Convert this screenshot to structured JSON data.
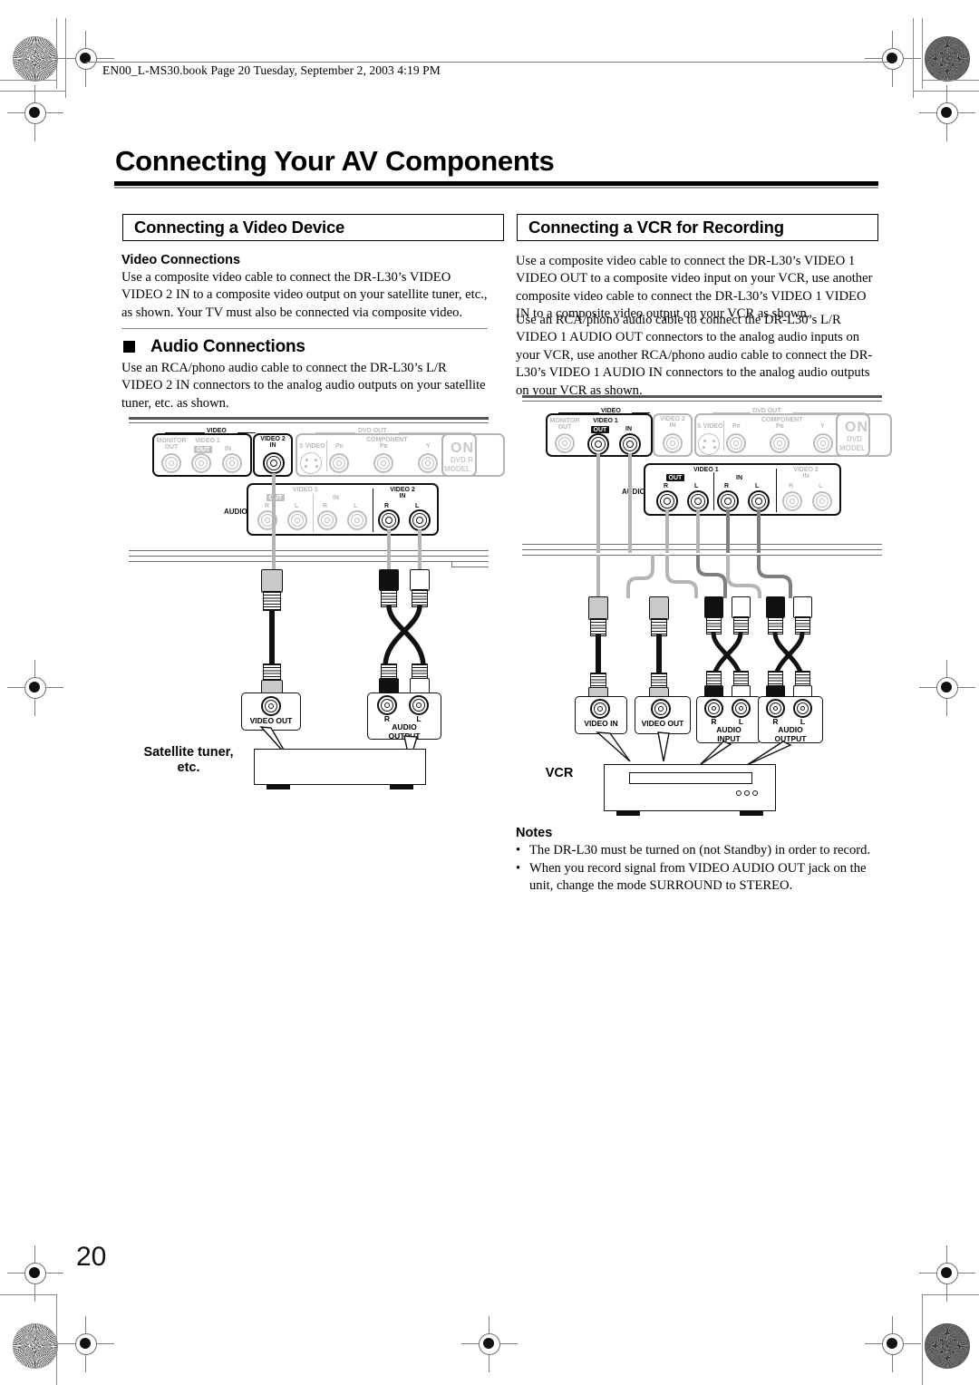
{
  "header": {
    "file_line": "EN00_L-MS30.book  Page 20  Tuesday, September 2, 2003  4:19 PM"
  },
  "page": {
    "title": "Connecting Your AV Components",
    "number": "20"
  },
  "left_column": {
    "section_title": "Connecting a Video Device",
    "video_subhead": "Video Connections",
    "video_body": "Use a composite video cable to connect the DR-L30’s VIDEO VIDEO 2 IN to a composite video output on your satellite tuner, etc., as shown. Your TV must also be connected via composite video.",
    "audio_head": "Audio Connections",
    "audio_body": "Use an RCA/phono audio cable to connect the DR-L30’s L/R VIDEO 2 IN connectors to the analog audio outputs on your satellite tuner, etc. as shown.",
    "device_label": "Satellite tuner,\netc.",
    "callouts": [
      {
        "title": "VIDEO OUT",
        "channels": []
      },
      {
        "title": "AUDIO\nOUTPUT",
        "channels": [
          "R",
          "L"
        ]
      }
    ]
  },
  "right_column": {
    "section_title": "Connecting a VCR for Recording",
    "body_1": "Use a composite video cable to connect the DR-L30’s VIDEO 1 VIDEO OUT to a composite video input on your VCR, use another composite video cable to connect the DR-L30’s VIDEO 1 VIDEO IN to a composite video output on your VCR as shown.",
    "body_2": "Use an RCA/phono audio cable to connect the DR-L30’s L/R VIDEO 1 AUDIO OUT connectors to the analog audio inputs on your VCR, use another RCA/phono audio cable to connect the DR-L30’s VIDEO 1 AUDIO IN connectors to the analog audio outputs on your VCR as shown.",
    "device_label": "VCR",
    "callouts": [
      {
        "title": "VIDEO IN",
        "channels": []
      },
      {
        "title": "VIDEO OUT",
        "channels": []
      },
      {
        "title": "AUDIO\nINPUT",
        "channels": [
          "R",
          "L"
        ]
      },
      {
        "title": "AUDIO\nOUTPUT",
        "channels": [
          "R",
          "L"
        ]
      }
    ],
    "notes_heading": "Notes",
    "notes": [
      "The DR-L30 must be turned on (not Standby) in order to record.",
      "When you record signal from VIDEO AUDIO OUT jack on the unit, change the mode SURROUND to STEREO."
    ]
  },
  "rear_panel": {
    "video_group": "VIDEO",
    "dvd_group": "DVD OUT",
    "component_group": "COMPONENT",
    "audio_label": "AUDIO",
    "labels": {
      "monitor_out": "MONITOR\nOUT",
      "video1": "VIDEO 1",
      "video2_in": "VIDEO 2\nIN",
      "out": "OUT",
      "in": "IN",
      "svideo": "S VIDEO",
      "pr": "PR",
      "pb": "PB",
      "y": "Y",
      "r": "R",
      "l": "L"
    },
    "brand": {
      "name": "ON",
      "line2": "DVD R",
      "line3": "MODEL"
    },
    "brand_right": {
      "name": "ON",
      "line2": "DVD",
      "line3": "MODEL"
    }
  },
  "colors": {
    "ink": "#000000",
    "dim": "#bdbdbd",
    "rule": "#8a8a8a",
    "plug_grey": "#c9c9c9",
    "plug_black": "#111111"
  }
}
